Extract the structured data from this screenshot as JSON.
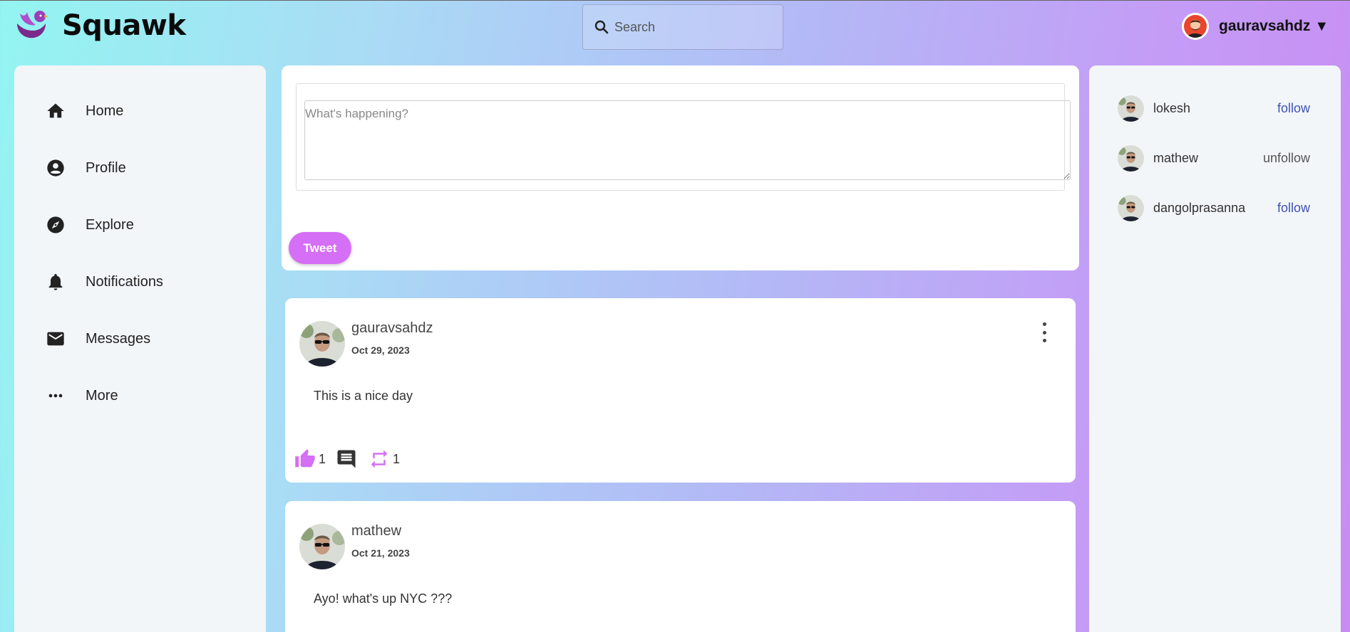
{
  "header": {
    "brand": "Squawk",
    "search_placeholder": "Search",
    "username": "gauravsahdz",
    "caret": "▼"
  },
  "sidebar": {
    "items": [
      {
        "label": "Home",
        "icon": "home-icon"
      },
      {
        "label": "Profile",
        "icon": "account-circle-icon"
      },
      {
        "label": "Explore",
        "icon": "compass-icon"
      },
      {
        "label": "Notifications",
        "icon": "bell-icon"
      },
      {
        "label": "Messages",
        "icon": "mail-icon"
      },
      {
        "label": "More",
        "icon": "more-horizontal-icon"
      }
    ]
  },
  "composer": {
    "placeholder": "What's happening?",
    "button": "Tweet"
  },
  "tweets": [
    {
      "author": "gauravsahdz",
      "date": "Oct 29, 2023",
      "text": "This is a nice day",
      "likes": "1",
      "retweets": "1"
    },
    {
      "author": "mathew",
      "date": "Oct 21, 2023",
      "text": "Ayo! what's up NYC ???"
    }
  ],
  "suggestions": [
    {
      "name": "lokesh",
      "action": "follow"
    },
    {
      "name": "mathew",
      "action": "unfollow"
    },
    {
      "name": "dangolprasanna",
      "action": "follow"
    }
  ],
  "colors": {
    "accent": "#d56ff5",
    "follow": "#3f51b5",
    "panel": "#f3f6f9"
  }
}
